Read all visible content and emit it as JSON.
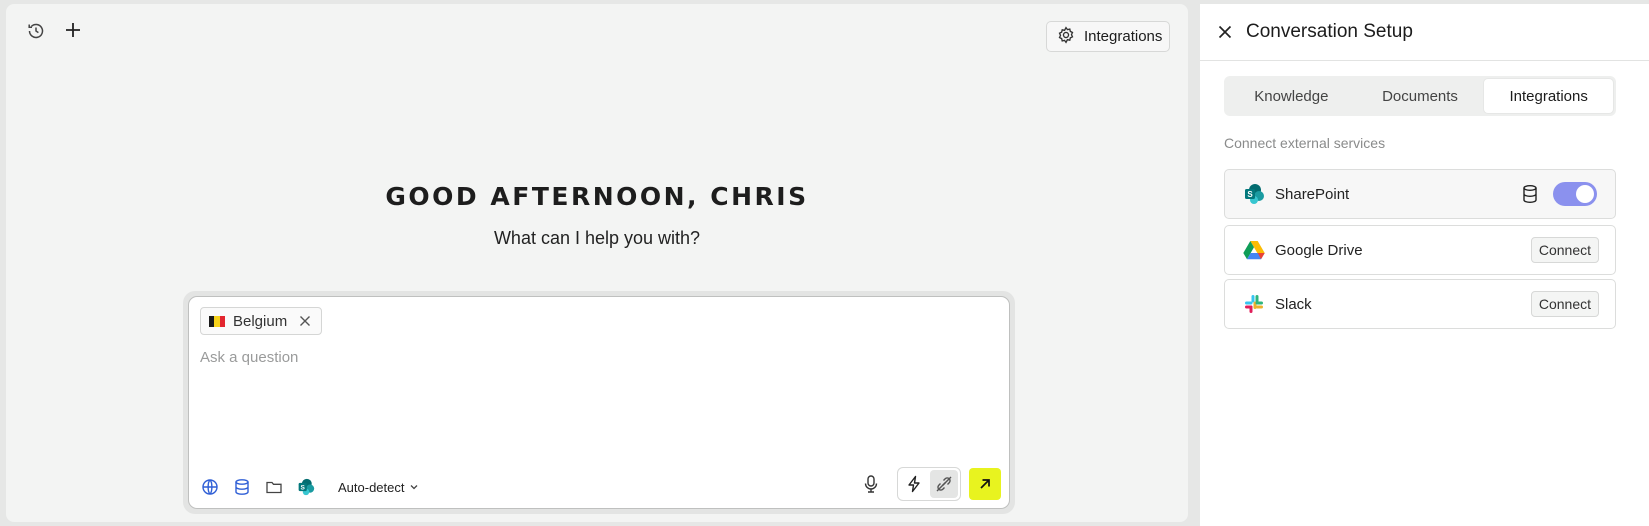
{
  "header": {
    "history_icon": "history-icon",
    "new_icon": "plus-icon",
    "integrations_label": "Integrations"
  },
  "greeting": {
    "title": "GOOD AFTERNOON, CHRIS",
    "subtitle": "What can I help you with?"
  },
  "composer": {
    "chip_label": "Belgium",
    "chip_flag_colors": [
      "#1a1a1a",
      "#f6d21b",
      "#e3262f"
    ],
    "placeholder": "Ask a question",
    "language_select": "Auto-detect",
    "send_color": "#e8f31f"
  },
  "panel": {
    "title": "Conversation Setup",
    "tabs": [
      {
        "label": "Knowledge",
        "active": false
      },
      {
        "label": "Documents",
        "active": false
      },
      {
        "label": "Integrations",
        "active": true
      }
    ],
    "section_label": "Connect external services",
    "services": [
      {
        "name": "SharePoint",
        "connected": true
      },
      {
        "name": "Google Drive",
        "connected": false,
        "action": "Connect"
      },
      {
        "name": "Slack",
        "connected": false,
        "action": "Connect"
      }
    ],
    "toggle_color": "#8b91ee"
  }
}
